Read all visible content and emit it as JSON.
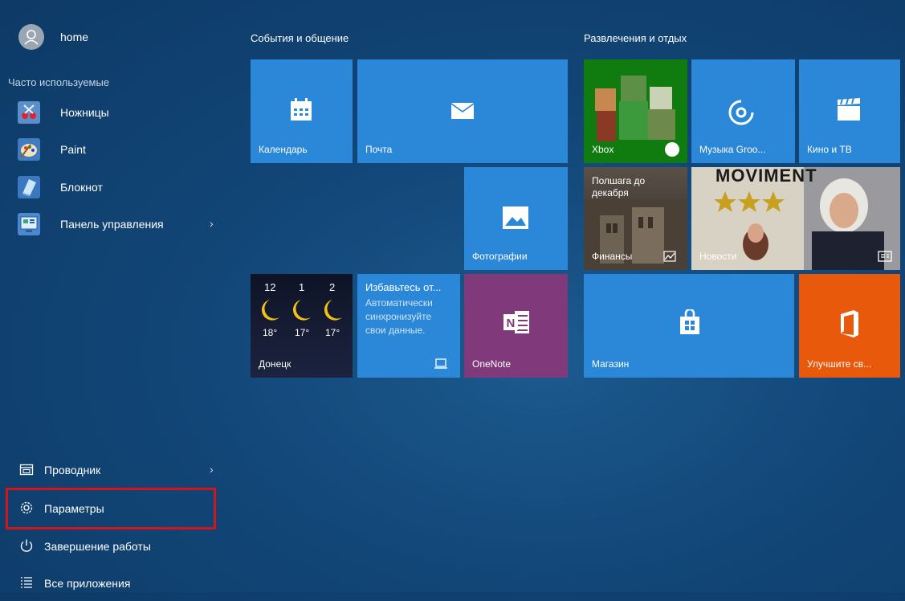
{
  "user": {
    "name": "home"
  },
  "frequent_header": "Часто используемые",
  "frequent": [
    {
      "label": "Ножницы"
    },
    {
      "label": "Paint"
    },
    {
      "label": "Блокнот"
    },
    {
      "label": "Панель управления",
      "chevron": "›"
    }
  ],
  "system": [
    {
      "label": "Проводник",
      "chevron": "›"
    },
    {
      "label": "Параметры"
    },
    {
      "label": "Завершение работы"
    },
    {
      "label": "Все приложения"
    }
  ],
  "groups": {
    "left": "События и общение",
    "right": "Развлечения и отдых"
  },
  "tiles": {
    "calendar": "Календарь",
    "mail": "Почта",
    "photos": "Фотографии",
    "weather": {
      "city": "Донецк",
      "hours": [
        "12",
        "1",
        "2"
      ],
      "temps": [
        "18°",
        "17°",
        "17°"
      ]
    },
    "sync": {
      "title": "Избавьтесь от...",
      "body": [
        "Автоматически",
        "синхронизуйте",
        "свои данные."
      ]
    },
    "onenote": "OneNote",
    "xbox": "Xbox",
    "music": "Музыка Groo...",
    "movies": "Кино и ТВ",
    "finance": {
      "text": [
        "Полшага до",
        "декабря"
      ],
      "label": "Финансы"
    },
    "news": {
      "label": "Новости",
      "banner": "MOVIMENT"
    },
    "store": "Магазин",
    "office": "Улучшите св..."
  },
  "colors": {
    "tile_blue": "#2b88d8",
    "onenote": "#80397b",
    "office": "#e8590c",
    "xbox": "#107c10",
    "highlight": "#d4141b"
  }
}
